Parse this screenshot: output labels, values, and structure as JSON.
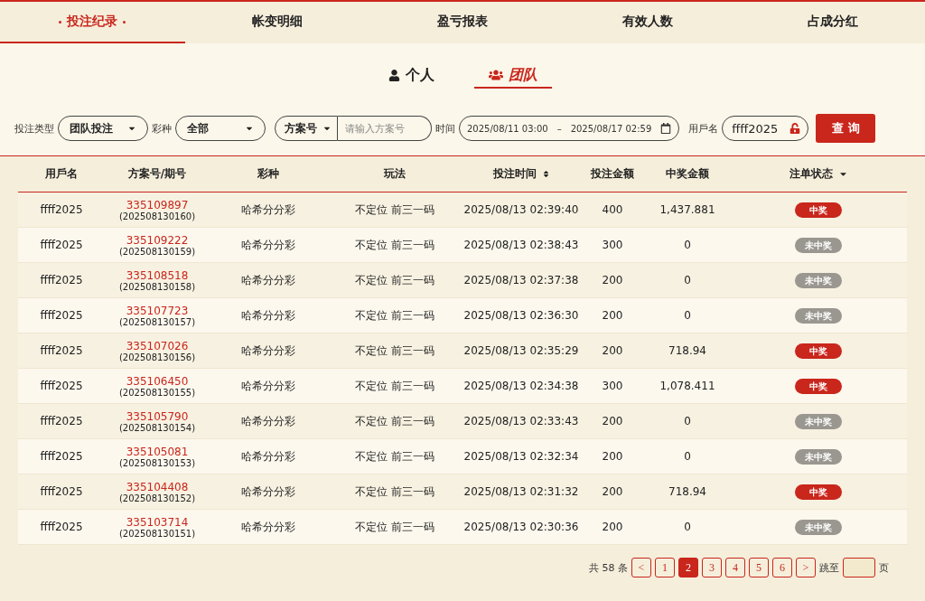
{
  "tabs": [
    {
      "label": "投注纪录",
      "selected": true
    },
    {
      "label": "帐变明细",
      "selected": false
    },
    {
      "label": "盈亏报表",
      "selected": false
    },
    {
      "label": "有效人数",
      "selected": false
    },
    {
      "label": "占成分红",
      "selected": false
    }
  ],
  "scope_tabs": [
    {
      "label": "个人",
      "kind": "person",
      "selected": false
    },
    {
      "label": "团队",
      "kind": "team",
      "selected": true
    }
  ],
  "filters": {
    "bet_type_label": "投注类型",
    "bet_type": "团队投注",
    "lottery_label": "彩种",
    "lottery": "全部",
    "plan_select": "方案号",
    "plan_placeholder": "请输入方案号",
    "time_label": "时间",
    "date_from": "2025/08/11 03:00",
    "date_sep": "–",
    "date_to": "2025/08/17 02:59",
    "user_label": "用戶名",
    "user": "ffff2025",
    "query_button": "查 询"
  },
  "table": {
    "columns": [
      "用戶名",
      "方案号/期号",
      "彩种",
      "玩法",
      "投注时间",
      "投注金额",
      "中奖金额",
      "注单状态"
    ],
    "rows": [
      {
        "user": "ffff2025",
        "plan": "335109897",
        "issue": "(202508130160)",
        "lottery": "哈希分分彩",
        "play": "不定位 前三一码",
        "time": "2025/08/13 02:39:40",
        "amount": "400",
        "prize": "1,437.881",
        "status": "中奖",
        "won": true
      },
      {
        "user": "ffff2025",
        "plan": "335109222",
        "issue": "(202508130159)",
        "lottery": "哈希分分彩",
        "play": "不定位 前三一码",
        "time": "2025/08/13 02:38:43",
        "amount": "300",
        "prize": "0",
        "status": "未中奖",
        "won": false
      },
      {
        "user": "ffff2025",
        "plan": "335108518",
        "issue": "(202508130158)",
        "lottery": "哈希分分彩",
        "play": "不定位 前三一码",
        "time": "2025/08/13 02:37:38",
        "amount": "200",
        "prize": "0",
        "status": "未中奖",
        "won": false
      },
      {
        "user": "ffff2025",
        "plan": "335107723",
        "issue": "(202508130157)",
        "lottery": "哈希分分彩",
        "play": "不定位 前三一码",
        "time": "2025/08/13 02:36:30",
        "amount": "200",
        "prize": "0",
        "status": "未中奖",
        "won": false
      },
      {
        "user": "ffff2025",
        "plan": "335107026",
        "issue": "(202508130156)",
        "lottery": "哈希分分彩",
        "play": "不定位 前三一码",
        "time": "2025/08/13 02:35:29",
        "amount": "200",
        "prize": "718.94",
        "status": "中奖",
        "won": true
      },
      {
        "user": "ffff2025",
        "plan": "335106450",
        "issue": "(202508130155)",
        "lottery": "哈希分分彩",
        "play": "不定位 前三一码",
        "time": "2025/08/13 02:34:38",
        "amount": "300",
        "prize": "1,078.411",
        "status": "中奖",
        "won": true
      },
      {
        "user": "ffff2025",
        "plan": "335105790",
        "issue": "(202508130154)",
        "lottery": "哈希分分彩",
        "play": "不定位 前三一码",
        "time": "2025/08/13 02:33:43",
        "amount": "200",
        "prize": "0",
        "status": "未中奖",
        "won": false
      },
      {
        "user": "ffff2025",
        "plan": "335105081",
        "issue": "(202508130153)",
        "lottery": "哈希分分彩",
        "play": "不定位 前三一码",
        "time": "2025/08/13 02:32:34",
        "amount": "200",
        "prize": "0",
        "status": "未中奖",
        "won": false
      },
      {
        "user": "ffff2025",
        "plan": "335104408",
        "issue": "(202508130152)",
        "lottery": "哈希分分彩",
        "play": "不定位 前三一码",
        "time": "2025/08/13 02:31:32",
        "amount": "200",
        "prize": "718.94",
        "status": "中奖",
        "won": true
      },
      {
        "user": "ffff2025",
        "plan": "335103714",
        "issue": "(202508130151)",
        "lottery": "哈希分分彩",
        "play": "不定位 前三一码",
        "time": "2025/08/13 02:30:36",
        "amount": "200",
        "prize": "0",
        "status": "未中奖",
        "won": false
      }
    ]
  },
  "pagination": {
    "total": "共 58 条",
    "prev": "<",
    "pages": [
      {
        "label": "1",
        "selected": false
      },
      {
        "label": "2",
        "selected": true
      },
      {
        "label": "3",
        "selected": false
      },
      {
        "label": "4",
        "selected": false
      },
      {
        "label": "5",
        "selected": false
      },
      {
        "label": "6",
        "selected": false
      }
    ],
    "next": ">",
    "jump_label": "跳至",
    "page_suffix": "页"
  }
}
